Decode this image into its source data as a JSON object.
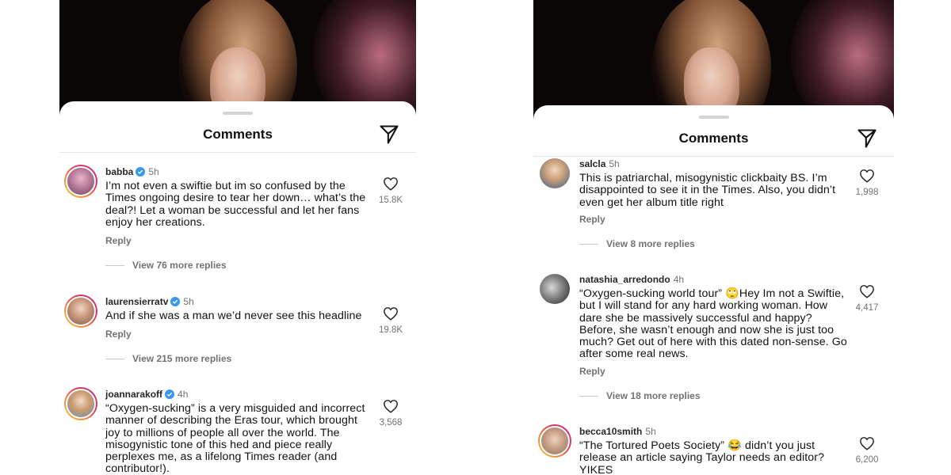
{
  "left": {
    "title": "Comments",
    "comments": [
      {
        "username": "babba",
        "time": "5h",
        "text": "I’m not even a swiftie but im so confused by the Times ongoing desire to tear her down… what’s the deal?! Let a woman be successful and let her fans enjoy her creations.",
        "reply": "Reply",
        "view_more": "View 76 more replies",
        "likes": "15.8K"
      },
      {
        "username": "laurensierratv",
        "time": "5h",
        "text": "And if she was a man we’d never see this headline",
        "reply": "Reply",
        "view_more": "View 215 more replies",
        "likes": "19.8K"
      },
      {
        "username": "joannarakoff",
        "time": "4h",
        "text": "“Oxygen-sucking” is a very misguided and incorrect manner of describing the Eras tour, which brought joy to millions of people all over the world. The misogynistic tone of this hed and piece really perplexes me, as a lifelong Times reader (and contributor!).",
        "likes": "3,568"
      }
    ]
  },
  "right": {
    "title": "Comments",
    "comments": [
      {
        "username": "salcla",
        "time": "5h",
        "text": "This is patriarchal, misogynistic clickbaity BS. I’m disappointed to see it in the Times. Also, you didn’t even get her album title right",
        "reply": "Reply",
        "view_more": "View 8 more replies",
        "likes": "1,998"
      },
      {
        "username": "natashia_arredondo",
        "time": "4h",
        "text": "“Oxygen-sucking world tour” 🙄Hey Im not a Swiftie, but I will stand for any hard working  woman. How dare she be massively successful and happy?  Before, she wasn’t enough and now she is just too much? Get out of here with this dated non-sense. Go after some real news.",
        "reply": "Reply",
        "view_more": "View 18 more replies",
        "likes": "4,417"
      },
      {
        "username": "becca10smith",
        "time": "5h",
        "text": "“The Tortured Poets Society” 😂 didn’t you just release an article saying Taylor needs an editor? YIKES",
        "likes": "6,200"
      }
    ]
  },
  "colors": {
    "verified": "#3897f0",
    "muted": "#737373",
    "ring_start": "#f9c846",
    "ring_end": "#c13584"
  }
}
